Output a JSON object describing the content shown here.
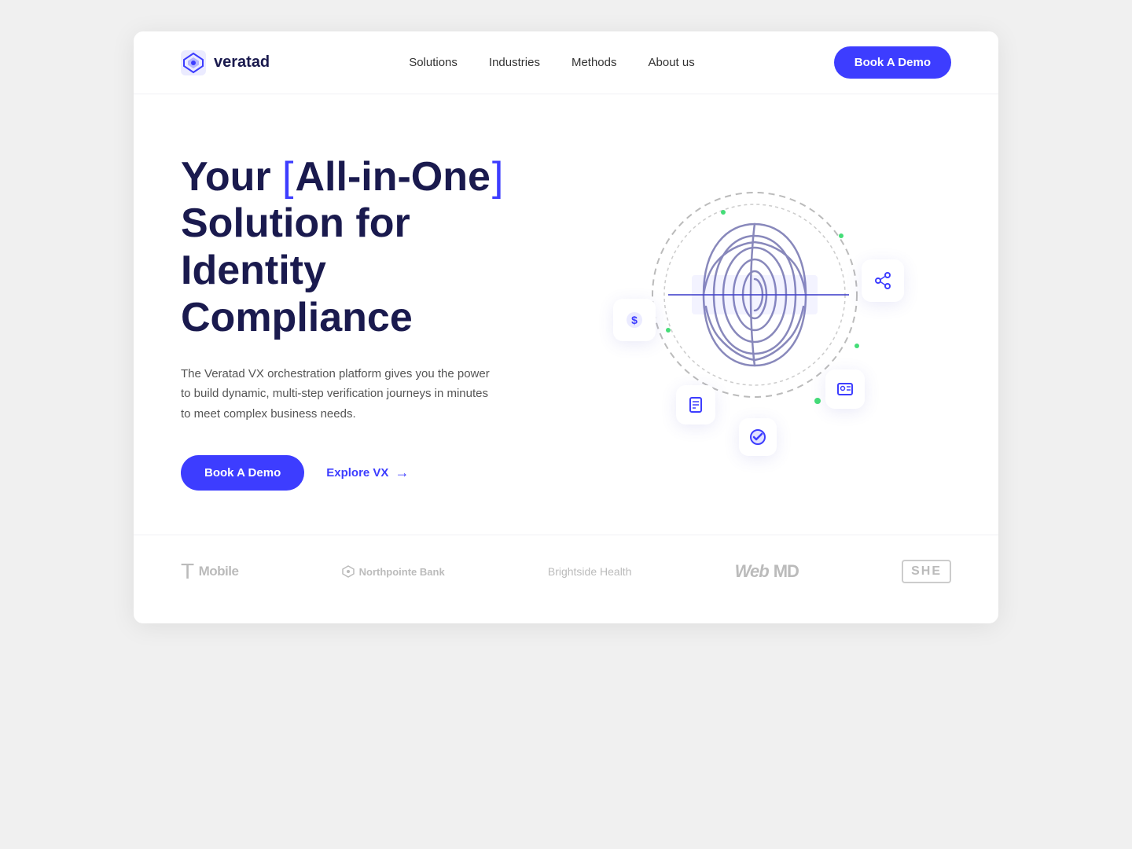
{
  "brand": {
    "name": "veratad",
    "logo_alt": "veratad logo"
  },
  "nav": {
    "links": [
      {
        "id": "solutions",
        "label": "Solutions"
      },
      {
        "id": "industries",
        "label": "Industries"
      },
      {
        "id": "methods",
        "label": "Methods"
      },
      {
        "id": "about",
        "label": "About us"
      }
    ],
    "cta_label": "Book A Demo"
  },
  "hero": {
    "title_pre": "Your ",
    "title_highlight": "All-in-One",
    "title_post": "Solution for Identity Compliance",
    "description": "The Veratad VX orchestration platform gives you the power to build dynamic, multi-step verification journeys in minutes to meet complex business needs.",
    "cta_primary": "Book A Demo",
    "cta_secondary": "Explore VX"
  },
  "logos": [
    {
      "id": "tmobile",
      "label": "T-Mobile",
      "prefix": "T "
    },
    {
      "id": "northpointe",
      "label": "Northpointe Bank"
    },
    {
      "id": "brightside",
      "label": "Brightside Health"
    },
    {
      "id": "webmd",
      "label": "WebMD"
    },
    {
      "id": "she",
      "label": "SHE"
    }
  ],
  "colors": {
    "brand_blue": "#3D3DFF",
    "dark_navy": "#1a1a4e",
    "text_muted": "#555555",
    "accent_green": "#44dd77"
  }
}
